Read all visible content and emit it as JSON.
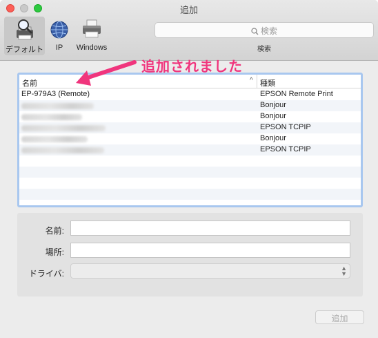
{
  "window": {
    "title": "追加"
  },
  "toolbar": {
    "items": [
      {
        "label": "デフォルト",
        "icon": "magnifier-printer-icon"
      },
      {
        "label": "IP",
        "icon": "globe-icon"
      },
      {
        "label": "Windows",
        "icon": "printer-icon"
      }
    ],
    "search_placeholder": "検索",
    "search_caption": "検索"
  },
  "annotation": {
    "text": "追加されました",
    "color": "#f0357d"
  },
  "list": {
    "header_name": "名前",
    "header_kind": "種類",
    "rows": [
      {
        "name": "EP-979A3 (Remote)",
        "kind": "EPSON Remote Print"
      },
      {
        "name": "",
        "kind": "Bonjour"
      },
      {
        "name": "",
        "kind": "Bonjour"
      },
      {
        "name": "",
        "kind": "EPSON TCPIP"
      },
      {
        "name": "",
        "kind": "Bonjour"
      },
      {
        "name": "",
        "kind": "EPSON TCPIP"
      }
    ]
  },
  "form": {
    "name_label": "名前:",
    "location_label": "場所:",
    "driver_label": "ドライバ:"
  },
  "buttons": {
    "add_label": "追加"
  }
}
